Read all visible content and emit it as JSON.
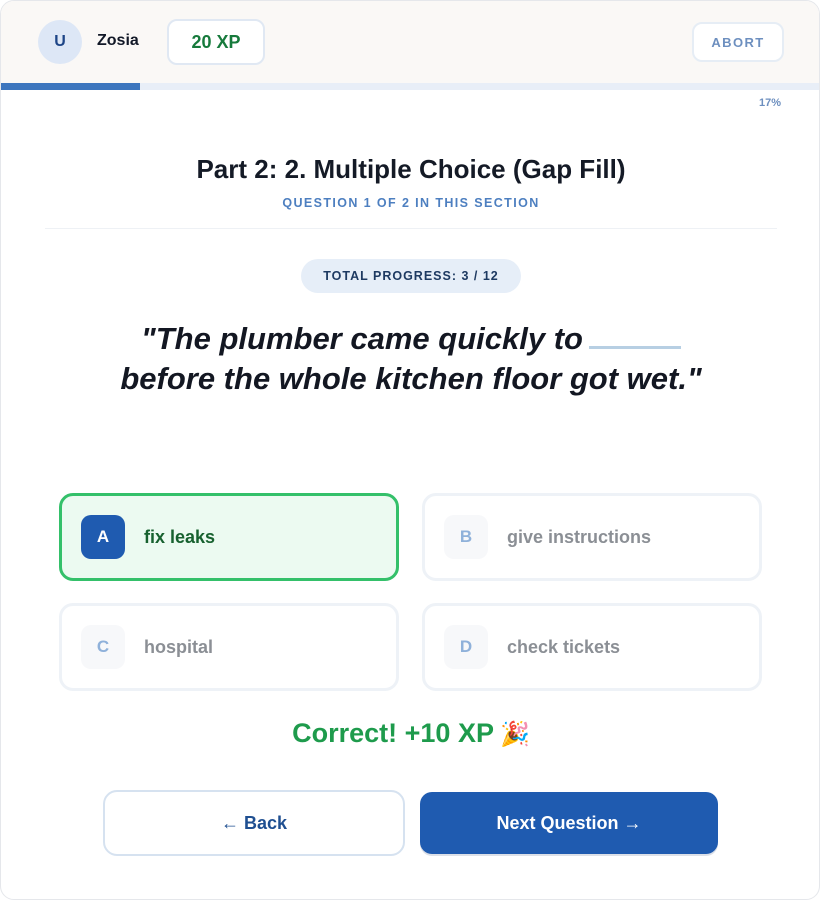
{
  "header": {
    "avatar_initial": "U",
    "username": "Zosia",
    "xp_label": "20 XP",
    "abort_label": "ABORT"
  },
  "progress": {
    "percent_value": 0.17,
    "percent_label": "17%"
  },
  "section": {
    "title": "Part 2: 2. Multiple Choice (Gap Fill)",
    "subtitle": "QUESTION 1 OF 2 IN THIS SECTION"
  },
  "total_progress_label": "TOTAL PROGRESS: 3 / 12",
  "question": {
    "before_gap": "\"The plumber came quickly to",
    "after_gap": "before the whole kitchen floor got wet.\""
  },
  "options": [
    {
      "letter": "A",
      "text": "fix leaks",
      "state": "correct"
    },
    {
      "letter": "B",
      "text": "give instructions",
      "state": "disabled"
    },
    {
      "letter": "C",
      "text": "hospital",
      "state": "disabled"
    },
    {
      "letter": "D",
      "text": "check tickets",
      "state": "disabled"
    }
  ],
  "feedback": {
    "text": "Correct! +10 XP",
    "icon": "party-popper-icon"
  },
  "nav": {
    "back_label": "← Back",
    "next_label": "Next Question →"
  },
  "colors": {
    "accent": "#1f5bb0",
    "correct": "#34c06a",
    "xp_text": "#177a3c"
  }
}
